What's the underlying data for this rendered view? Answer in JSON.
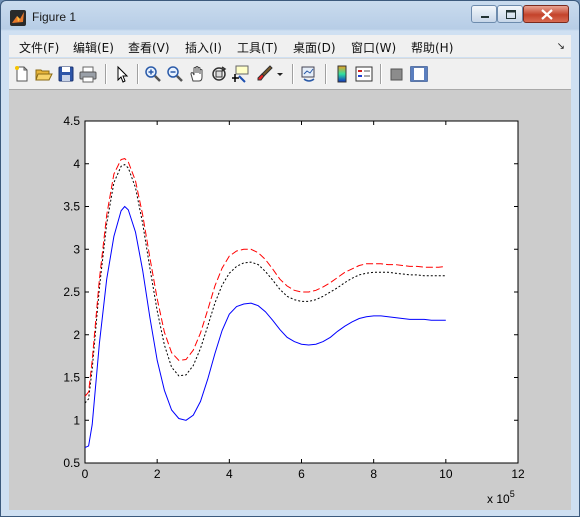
{
  "window": {
    "title": "Figure 1"
  },
  "menu": {
    "items": [
      "文件(F)",
      "编辑(E)",
      "查看(V)",
      "插入(I)",
      "工具(T)",
      "桌面(D)",
      "窗口(W)",
      "帮助(H)"
    ]
  },
  "toolbar": {
    "icons": [
      "new-figure-icon",
      "open-file-icon",
      "save-figure-icon",
      "print-figure-icon",
      "edit-plot-arrow-icon",
      "zoom-in-icon",
      "zoom-out-icon",
      "pan-hand-icon",
      "rotate-3d-icon",
      "data-cursor-icon",
      "brush-icon",
      "link-plot-icon",
      "colorbar-icon",
      "legend-icon",
      "hide-plot-tools-icon",
      "show-plot-tools-icon"
    ]
  },
  "colors": {
    "series_solid": "#0000ff",
    "series_dotted": "#000000",
    "series_dashed": "#ff0000",
    "figure_bg": "#cccccc"
  },
  "chart_data": {
    "type": "line",
    "title": "",
    "xlabel": "",
    "ylabel": "",
    "x_exponent_label": "x 10^5",
    "xlim": [
      0,
      12
    ],
    "ylim": [
      0.5,
      4.5
    ],
    "xticks": [
      0,
      2,
      4,
      6,
      8,
      10,
      12
    ],
    "yticks": [
      0.5,
      1,
      1.5,
      2,
      2.5,
      3,
      3.5,
      4,
      4.5
    ],
    "xtick_labels": [
      "0",
      "2",
      "4",
      "6",
      "8",
      "10",
      "12"
    ],
    "ytick_labels": [
      "0.5",
      "1",
      "1.5",
      "2",
      "2.5",
      "3",
      "3.5",
      "4",
      "4.5"
    ],
    "grid": false,
    "series": [
      {
        "style": "solid",
        "color": "#0000ff",
        "x": [
          0,
          0.1,
          0.2,
          0.4,
          0.6,
          0.8,
          1.0,
          1.1,
          1.2,
          1.4,
          1.6,
          1.8,
          2.0,
          2.2,
          2.4,
          2.6,
          2.8,
          3.0,
          3.2,
          3.4,
          3.6,
          3.8,
          4.0,
          4.2,
          4.4,
          4.6,
          4.8,
          5.0,
          5.2,
          5.4,
          5.6,
          5.8,
          6.0,
          6.2,
          6.4,
          6.6,
          6.8,
          7.0,
          7.2,
          7.4,
          7.6,
          7.8,
          8.0,
          8.2,
          8.4,
          8.6,
          8.8,
          9.0,
          9.2,
          9.4,
          9.6,
          9.8,
          10.0
        ],
        "y": [
          0.68,
          0.7,
          0.95,
          1.9,
          2.65,
          3.15,
          3.45,
          3.5,
          3.46,
          3.2,
          2.75,
          2.2,
          1.7,
          1.35,
          1.12,
          1.02,
          1.0,
          1.06,
          1.22,
          1.48,
          1.78,
          2.05,
          2.24,
          2.33,
          2.36,
          2.37,
          2.34,
          2.27,
          2.17,
          2.06,
          1.97,
          1.92,
          1.89,
          1.88,
          1.89,
          1.92,
          1.97,
          2.04,
          2.1,
          2.15,
          2.19,
          2.21,
          2.22,
          2.22,
          2.21,
          2.2,
          2.19,
          2.18,
          2.18,
          2.18,
          2.17,
          2.17,
          2.17
        ]
      },
      {
        "style": "dotted",
        "color": "#000000",
        "x": [
          0,
          0.1,
          0.2,
          0.4,
          0.6,
          0.8,
          1.0,
          1.1,
          1.2,
          1.4,
          1.6,
          1.8,
          2.0,
          2.2,
          2.4,
          2.6,
          2.8,
          3.0,
          3.2,
          3.4,
          3.6,
          3.8,
          4.0,
          4.2,
          4.4,
          4.6,
          4.8,
          5.0,
          5.2,
          5.4,
          5.6,
          5.8,
          6.0,
          6.2,
          6.4,
          6.6,
          6.8,
          7.0,
          7.2,
          7.4,
          7.6,
          7.8,
          8.0,
          8.2,
          8.4,
          8.6,
          8.8,
          9.0,
          9.2,
          9.4,
          9.6,
          9.8,
          10.0
        ],
        "y": [
          1.2,
          1.25,
          1.6,
          2.55,
          3.3,
          3.78,
          3.97,
          3.99,
          3.95,
          3.72,
          3.3,
          2.78,
          2.28,
          1.88,
          1.62,
          1.52,
          1.53,
          1.64,
          1.84,
          2.1,
          2.37,
          2.58,
          2.72,
          2.8,
          2.84,
          2.85,
          2.82,
          2.74,
          2.64,
          2.53,
          2.45,
          2.41,
          2.39,
          2.39,
          2.41,
          2.45,
          2.5,
          2.55,
          2.61,
          2.66,
          2.7,
          2.72,
          2.73,
          2.73,
          2.73,
          2.72,
          2.71,
          2.7,
          2.7,
          2.69,
          2.69,
          2.69,
          2.69
        ]
      },
      {
        "style": "dashed",
        "color": "#ff0000",
        "x": [
          0,
          0.1,
          0.2,
          0.4,
          0.6,
          0.8,
          1.0,
          1.1,
          1.2,
          1.4,
          1.6,
          1.8,
          2.0,
          2.2,
          2.4,
          2.6,
          2.8,
          3.0,
          3.2,
          3.4,
          3.6,
          3.8,
          4.0,
          4.2,
          4.4,
          4.6,
          4.8,
          5.0,
          5.2,
          5.4,
          5.6,
          5.8,
          6.0,
          6.2,
          6.4,
          6.6,
          6.8,
          7.0,
          7.2,
          7.4,
          7.6,
          7.8,
          8.0,
          8.2,
          8.4,
          8.6,
          8.8,
          9.0,
          9.2,
          9.4,
          9.6,
          9.8,
          10.0
        ],
        "y": [
          1.28,
          1.33,
          1.7,
          2.65,
          3.4,
          3.88,
          4.05,
          4.06,
          4.02,
          3.8,
          3.4,
          2.9,
          2.42,
          2.03,
          1.79,
          1.7,
          1.71,
          1.82,
          2.02,
          2.29,
          2.57,
          2.78,
          2.92,
          2.98,
          3.0,
          3.0,
          2.96,
          2.88,
          2.77,
          2.65,
          2.57,
          2.52,
          2.5,
          2.5,
          2.52,
          2.56,
          2.61,
          2.67,
          2.73,
          2.77,
          2.81,
          2.83,
          2.83,
          2.83,
          2.82,
          2.82,
          2.81,
          2.8,
          2.8,
          2.79,
          2.79,
          2.79,
          2.8
        ]
      }
    ]
  }
}
